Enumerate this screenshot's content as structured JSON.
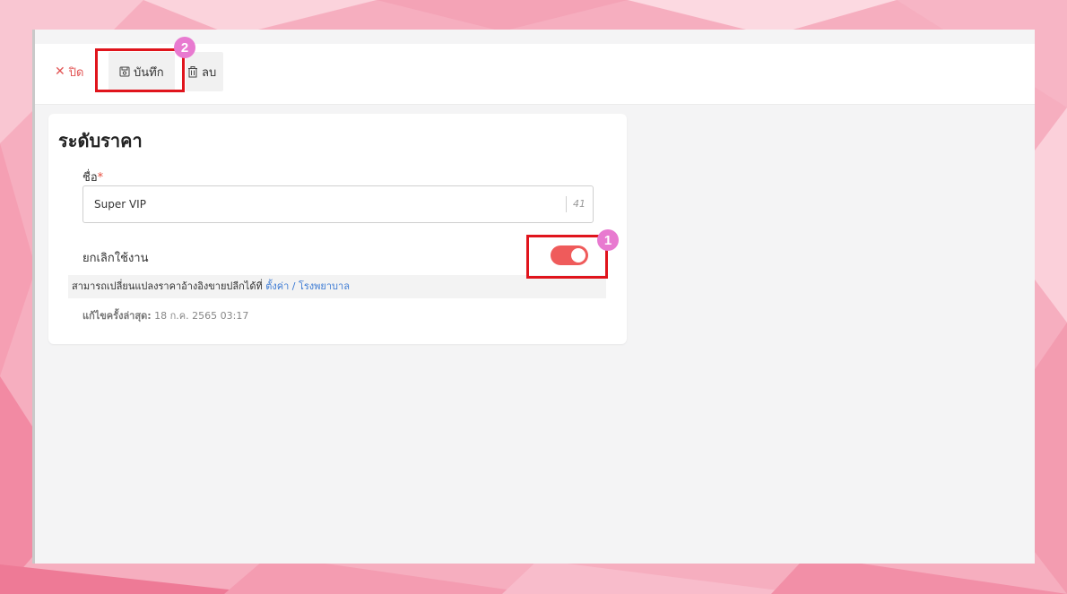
{
  "toolbar": {
    "close_label": "ปิด",
    "save_label": "บันทึก",
    "delete_label": "ลบ"
  },
  "form": {
    "title": "ระดับราคา",
    "name_label": "ชื่อ",
    "required_mark": "*",
    "name_value": "Super VIP",
    "char_count": "41",
    "toggle_label": "ยกเลิกใช้งาน",
    "toggle_on": true,
    "info_text": "สามารถเปลี่ยนแปลงราคาอ้างอิงขายปลีกได้ที่",
    "info_link": "ตั้งค่า / โรงพยาบาล",
    "last_edit_label": "แก้ไขครั้งล่าสุด:",
    "last_edit_value": "18 ก.ค. 2565 03:17"
  },
  "annotations": {
    "badge_1": "1",
    "badge_2": "2"
  },
  "colors": {
    "accent_red": "#ef5b5b",
    "highlight": "#e0141c",
    "badge": "#e87ad0",
    "link": "#3d7bd4"
  }
}
